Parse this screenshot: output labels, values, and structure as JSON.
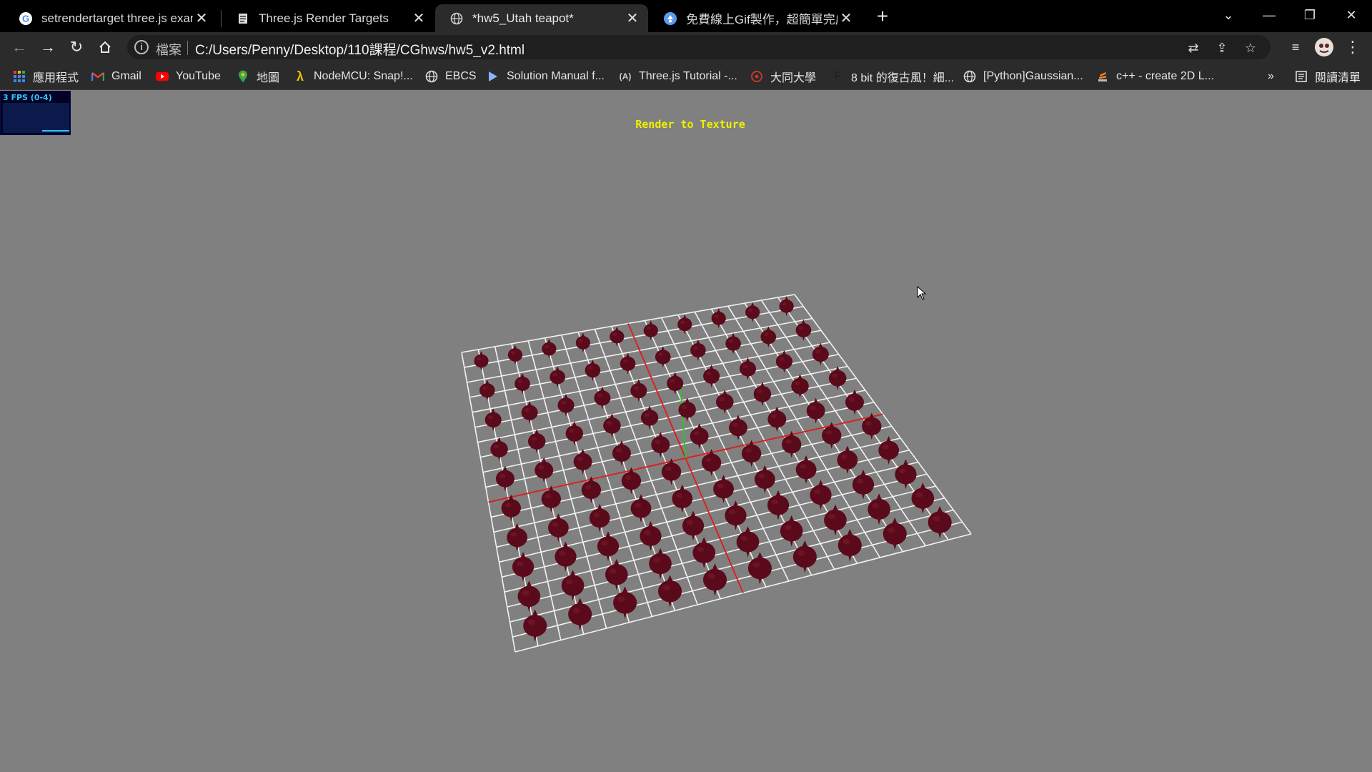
{
  "tabs": [
    {
      "label": "setrendertarget three.js examp",
      "icon": "google-icon",
      "active": false
    },
    {
      "label": "Three.js Render Targets",
      "icon": "document-icon",
      "active": false
    },
    {
      "label": "*hw5_Utah teapot*",
      "icon": "globe-icon",
      "active": true
    },
    {
      "label": "免費線上Gif製作，超簡單完成影",
      "icon": "web-app-icon",
      "active": false
    }
  ],
  "toolbar": {
    "scheme_label": "檔案",
    "url": "C:/Users/Penny/Desktop/110課程/CGhws/hw5_v2.html"
  },
  "bookmarks": [
    {
      "label": "應用程式",
      "icon": "apps-grid-icon"
    },
    {
      "label": "Gmail",
      "icon": "gmail-icon"
    },
    {
      "label": "YouTube",
      "icon": "youtube-icon"
    },
    {
      "label": "地圖",
      "icon": "maps-pin-icon"
    },
    {
      "label": "NodeMCU: Snap!...",
      "icon": "lambda-icon"
    },
    {
      "label": "EBCS",
      "icon": "globe-icon"
    },
    {
      "label": "Solution Manual f...",
      "icon": "play-arrow-icon"
    },
    {
      "label": "Three.js Tutorial -...",
      "icon": "brackets-icon"
    },
    {
      "label": "大同大學",
      "icon": "university-icon"
    },
    {
      "label": "8 bit 的復古風！細...",
      "icon": "f-icon"
    },
    {
      "label": "[Python]Gaussian...",
      "icon": "globe-icon"
    },
    {
      "label": "c++ - create 2D L...",
      "icon": "stack-icon"
    }
  ],
  "reading_list_label": "閱讀清單",
  "page": {
    "stats_label": "3 FPS (0-4)",
    "title": "Render to Texture"
  },
  "colors": {
    "background": "#808080",
    "title": "#f0f000",
    "teapot": "#5a0a1a",
    "grid": "#f2f2f2",
    "axis_x": "#d62020",
    "axis_y": "#30c030",
    "stats_text": "#2ec6ff"
  }
}
